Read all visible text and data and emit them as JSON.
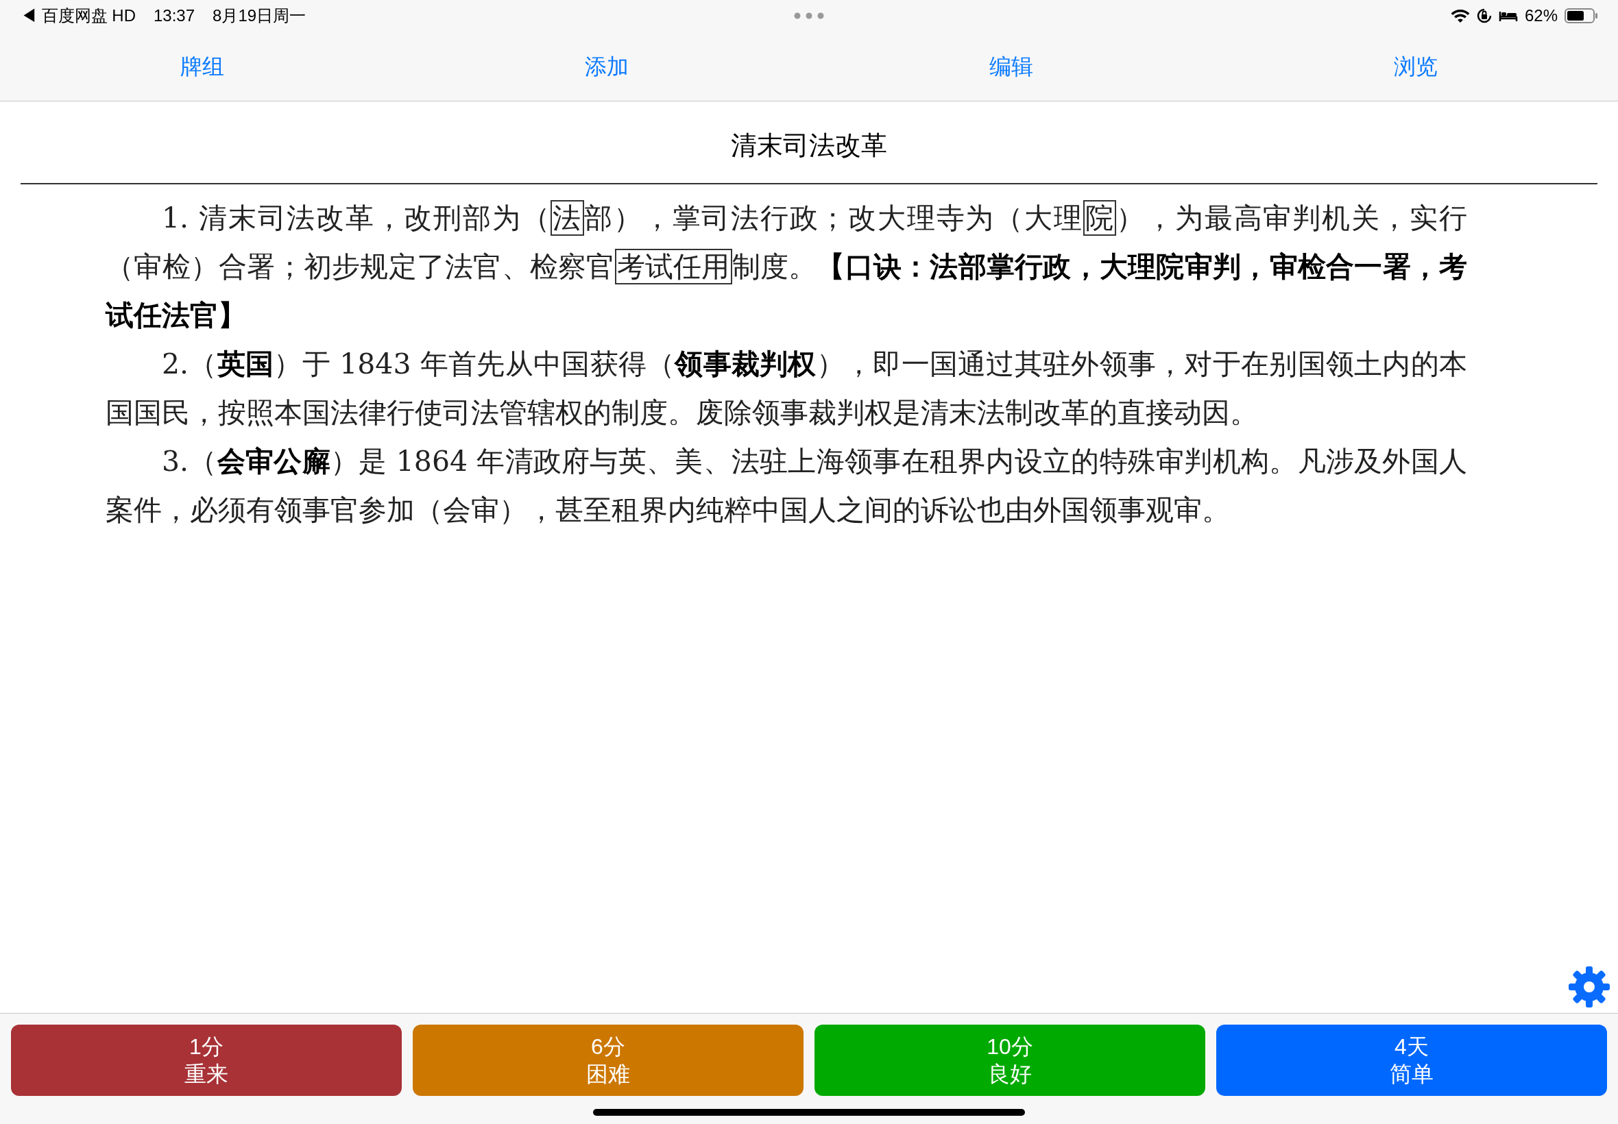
{
  "status_bar": {
    "back_app": "◀ 百度网盘 HD",
    "time": "13:37",
    "date": "8月19日周一",
    "battery": "62%"
  },
  "toolbar": [
    "牌组",
    "添加",
    "编辑",
    "浏览"
  ],
  "card": {
    "title": "清末司法改革",
    "paragraphs": [
      [
        {
          "kind": "text",
          "text": "1. 清末司法改革，改刑部为（"
        },
        {
          "kind": "boxed",
          "text": "法"
        },
        {
          "kind": "text",
          "text": "部），掌司法行政；改大理寺为（大理"
        },
        {
          "kind": "boxed",
          "text": "院"
        },
        {
          "kind": "text",
          "text": "），为最高审判机关，实行（审检）合署；初步规定了法官、检察官"
        },
        {
          "kind": "boxed",
          "text": "考试任用"
        },
        {
          "kind": "text",
          "text": "制度。"
        },
        {
          "kind": "bold",
          "text": "【口诀：法部掌行政，大理院审判，审检合一署，考试任法官】"
        }
      ],
      [
        {
          "kind": "text",
          "text": "2.（"
        },
        {
          "kind": "bold",
          "text": "英国"
        },
        {
          "kind": "text",
          "text": "）于 1843 年首先从中国获得（"
        },
        {
          "kind": "bold",
          "text": "领事裁判权"
        },
        {
          "kind": "text",
          "text": "），即一国通过其驻外领事，对于在别国领土内的本国国民，按照本国法律行使司法管辖权的制度。废除领事裁判权是清末法制改革的直接动因。"
        }
      ],
      [
        {
          "kind": "text",
          "text": "3.（"
        },
        {
          "kind": "bold",
          "text": "会审公廨"
        },
        {
          "kind": "text",
          "text": "）是 1864 年清政府与英、美、法驻上海领事在租界内设立的特殊审判机构。凡涉及外国人案件，必须有领事官参加（会审），甚至租界内纯粹中国人之间的诉讼也由外国领事观审。"
        }
      ]
    ]
  },
  "answer_buttons": [
    {
      "interval": "1分",
      "label": "重来",
      "color": "#a83236"
    },
    {
      "interval": "6分",
      "label": "困难",
      "color": "#cc7700"
    },
    {
      "interval": "10分",
      "label": "良好",
      "color": "#00aa00"
    },
    {
      "interval": "4天",
      "label": "简单",
      "color": "#0068ff"
    }
  ]
}
